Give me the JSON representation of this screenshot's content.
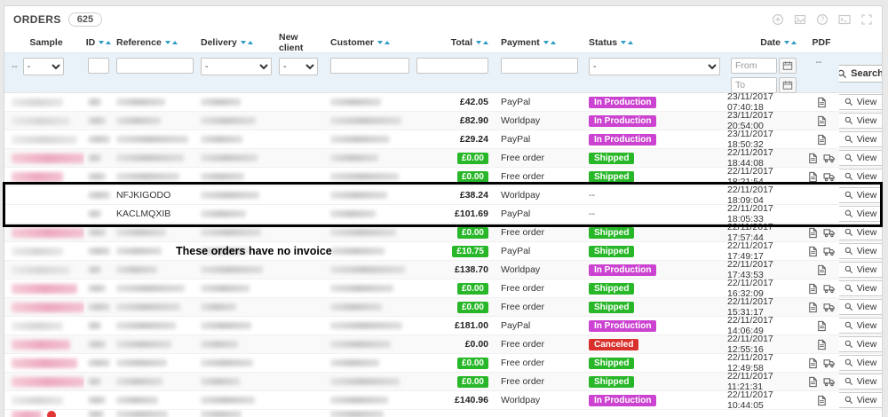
{
  "panel": {
    "title": "ORDERS",
    "count": "625"
  },
  "toolbar": {
    "icons": [
      {
        "name": "add"
      },
      {
        "name": "export-image"
      },
      {
        "name": "help"
      },
      {
        "name": "sql"
      },
      {
        "name": "expand"
      }
    ]
  },
  "columns": [
    {
      "label": "Sample",
      "sortable": false
    },
    {
      "label": "ID",
      "sortable": true
    },
    {
      "label": "Reference",
      "sortable": true
    },
    {
      "label": "Delivery",
      "sortable": true
    },
    {
      "label": "New client",
      "sortable": false
    },
    {
      "label": "Customer",
      "sortable": true
    },
    {
      "label": "Total",
      "sortable": true
    },
    {
      "label": "Payment",
      "sortable": true
    },
    {
      "label": "Status",
      "sortable": true
    },
    {
      "label": "Date",
      "sortable": true
    },
    {
      "label": "PDF",
      "sortable": false
    }
  ],
  "filters": {
    "prefix": "--",
    "sample": "-",
    "delivery": "-",
    "new_client": "-",
    "status": "-",
    "from": "From",
    "to": "To",
    "pdf": "--",
    "search": "Search"
  },
  "labels": {
    "view": "View"
  },
  "annotation": "These orders have no invoice",
  "colors": {
    "accent_blue": "#2e9cc7",
    "badge_production": "#cb43d0",
    "badge_shipped": "#28b728",
    "badge_canceled": "#d9302c",
    "badge_money": "#28b728",
    "highlight": "#000000"
  },
  "rows": [
    {
      "sample": "gray",
      "reference": "",
      "total": "£42.05",
      "total_badge": false,
      "payment": "PayPal",
      "status": "In Production",
      "status_type": "production",
      "date": "23/11/2017 07:40:18",
      "pdf": [
        "invoice"
      ],
      "highlight": false
    },
    {
      "sample": "gray",
      "reference": "",
      "total": "£82.90",
      "total_badge": false,
      "payment": "Worldpay",
      "status": "In Production",
      "status_type": "production",
      "date": "23/11/2017 20:54:00",
      "pdf": [
        "invoice"
      ],
      "highlight": false
    },
    {
      "sample": "gray",
      "reference": "",
      "total": "£29.24",
      "total_badge": false,
      "payment": "PayPal",
      "status": "In Production",
      "status_type": "production",
      "date": "23/11/2017 18:50:32",
      "pdf": [
        "invoice"
      ],
      "highlight": false
    },
    {
      "sample": "pink",
      "reference": "",
      "total": "£0.00",
      "total_badge": true,
      "payment": "Free order",
      "status": "Shipped",
      "status_type": "shipped",
      "date": "22/11/2017 18:44:08",
      "pdf": [
        "invoice",
        "delivery"
      ],
      "highlight": false
    },
    {
      "sample": "pink",
      "reference": "",
      "total": "£0.00",
      "total_badge": true,
      "payment": "Free order",
      "status": "Shipped",
      "status_type": "shipped",
      "date": "22/11/2017 18:21:54",
      "pdf": [
        "invoice",
        "delivery"
      ],
      "highlight": false
    },
    {
      "sample": "none",
      "reference": "NFJKIGODO",
      "total": "£38.24",
      "total_badge": false,
      "payment": "Worldpay",
      "status": "--",
      "status_type": "none",
      "date": "22/11/2017 18:09:04",
      "pdf": [],
      "highlight": true
    },
    {
      "sample": "none",
      "reference": "KACLMQXIB",
      "total": "£101.69",
      "total_badge": false,
      "payment": "PayPal",
      "status": "--",
      "status_type": "none",
      "date": "22/11/2017 18:05:33",
      "pdf": [],
      "highlight": true
    },
    {
      "sample": "pink",
      "reference": "",
      "total": "£0.00",
      "total_badge": true,
      "payment": "Free order",
      "status": "Shipped",
      "status_type": "shipped",
      "date": "22/11/2017 17:57:44",
      "pdf": [
        "invoice",
        "delivery"
      ],
      "highlight": false
    },
    {
      "sample": "gray",
      "reference": "",
      "total": "£10.75",
      "total_badge": true,
      "payment": "PayPal",
      "status": "Shipped",
      "status_type": "shipped",
      "date": "22/11/2017 17:49:17",
      "pdf": [
        "invoice",
        "delivery"
      ],
      "highlight": false
    },
    {
      "sample": "gray",
      "reference": "",
      "total": "£138.70",
      "total_badge": false,
      "payment": "Worldpay",
      "status": "In Production",
      "status_type": "production",
      "date": "22/11/2017 17:43:53",
      "pdf": [
        "invoice"
      ],
      "highlight": false
    },
    {
      "sample": "pink",
      "reference": "",
      "total": "£0.00",
      "total_badge": true,
      "payment": "Free order",
      "status": "Shipped",
      "status_type": "shipped",
      "date": "22/11/2017 16:32:09",
      "pdf": [
        "invoice",
        "delivery"
      ],
      "highlight": false
    },
    {
      "sample": "pink",
      "reference": "",
      "total": "£0.00",
      "total_badge": true,
      "payment": "Free order",
      "status": "Shipped",
      "status_type": "shipped",
      "date": "22/11/2017 15:31:17",
      "pdf": [
        "invoice",
        "delivery"
      ],
      "highlight": false
    },
    {
      "sample": "gray",
      "reference": "",
      "total": "£181.00",
      "total_badge": false,
      "payment": "PayPal",
      "status": "In Production",
      "status_type": "production",
      "date": "22/11/2017 14:06:49",
      "pdf": [
        "invoice"
      ],
      "highlight": false
    },
    {
      "sample": "pink",
      "reference": "",
      "total": "£0.00",
      "total_badge": false,
      "payment": "Free order",
      "status": "Canceled",
      "status_type": "canceled",
      "date": "22/11/2017 12:55:16",
      "pdf": [
        "invoice"
      ],
      "highlight": false
    },
    {
      "sample": "pink",
      "reference": "",
      "total": "£0.00",
      "total_badge": true,
      "payment": "Free order",
      "status": "Shipped",
      "status_type": "shipped",
      "date": "22/11/2017 12:49:58",
      "pdf": [
        "invoice",
        "delivery"
      ],
      "highlight": false
    },
    {
      "sample": "pink",
      "reference": "",
      "total": "£0.00",
      "total_badge": true,
      "payment": "Free order",
      "status": "Shipped",
      "status_type": "shipped",
      "date": "22/11/2017 11:21:31",
      "pdf": [
        "invoice",
        "delivery"
      ],
      "highlight": false
    },
    {
      "sample": "gray",
      "reference": "",
      "total": "£140.96",
      "total_badge": false,
      "payment": "Worldpay",
      "status": "In Production",
      "status_type": "production",
      "date": "22/11/2017 10:44:05",
      "pdf": [
        "invoice"
      ],
      "highlight": false
    }
  ]
}
